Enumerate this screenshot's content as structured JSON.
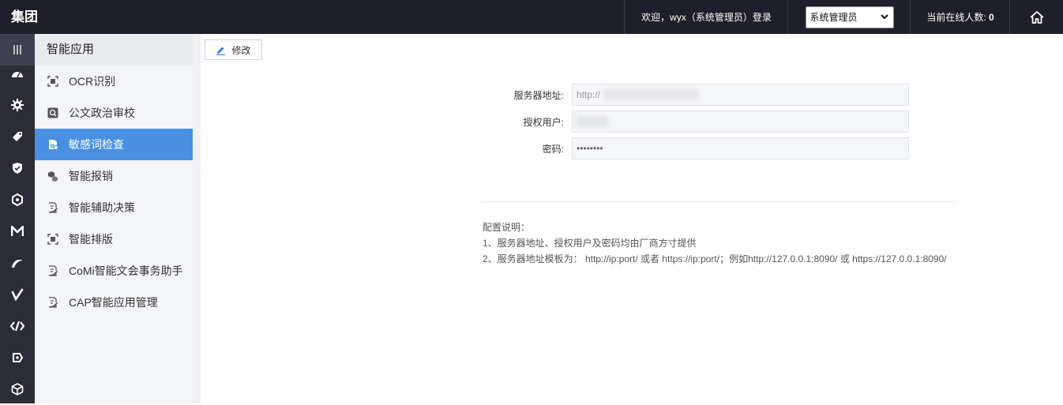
{
  "app": {
    "brand": "集团"
  },
  "header": {
    "welcome": "欢迎，wyx（系统管理员）登录",
    "role_selected": "系统管理员",
    "online_label": "当前在线人数:",
    "online_count": "0"
  },
  "rail": {
    "icons": [
      "menu-icon",
      "dashboard-icon",
      "gear-icon",
      "tag-icon",
      "shield-icon",
      "hexagon-icon",
      "m-logo-icon",
      "swoosh-icon",
      "v-check-icon",
      "code-icon",
      "chip-icon",
      "cube-icon"
    ]
  },
  "sidebar": {
    "title": "智能应用",
    "items": [
      {
        "label": "OCR识别",
        "icon": "scan-icon",
        "active": false
      },
      {
        "label": "公文政治审校",
        "icon": "search-doc-icon",
        "active": false
      },
      {
        "label": "敏感词检查",
        "icon": "sensitive-doc-icon",
        "active": true
      },
      {
        "label": "智能报销",
        "icon": "cubes-icon",
        "active": false
      },
      {
        "label": "智能辅助决策",
        "icon": "doc-edit-icon",
        "active": false
      },
      {
        "label": "智能排版",
        "icon": "scan-icon",
        "active": false
      },
      {
        "label": "CoMi智能文会事务助手",
        "icon": "doc-edit-icon",
        "active": false
      },
      {
        "label": "CAP智能应用管理",
        "icon": "doc-edit-icon",
        "active": false
      }
    ]
  },
  "toolbar": {
    "edit_label": "修改"
  },
  "form": {
    "server_label": "服务器地址:",
    "server_value": "http://",
    "user_label": "授权用户:",
    "user_value": "",
    "password_label": "密码:",
    "password_value": "••••••••"
  },
  "notes": {
    "title": "配置说明：",
    "line1": "1、服务器地址、授权用户及密码均由厂商方寸提供",
    "line2": "2、服务器地址模板为： http://ip:port/ 或者 https://ip:port/；例如http://127.0.0.1:8090/ 或 https://127.0.0.1:8090/"
  },
  "colors": {
    "topbar": "#1f1f2b",
    "rail": "#2b2c38",
    "accent": "#4a90e2",
    "sidebar_bg": "#f4f5f8"
  }
}
